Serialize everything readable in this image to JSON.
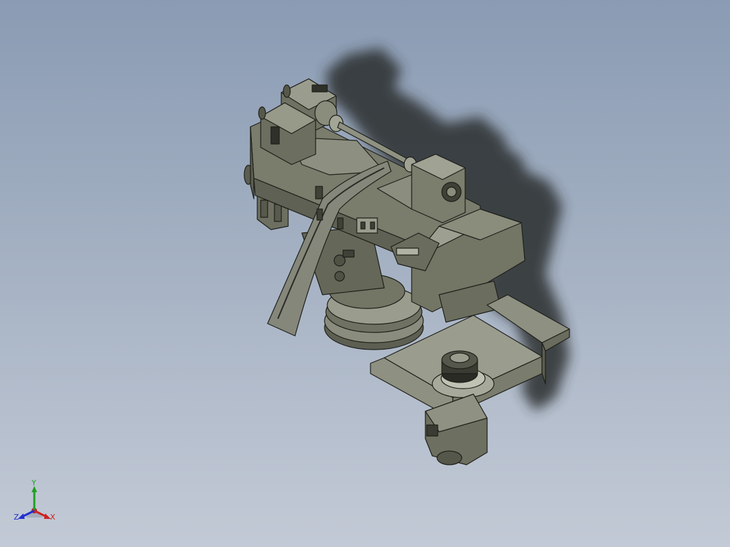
{
  "viewport": {
    "background_top": "#8a9bb3",
    "background_bottom": "#c3cad6",
    "model_color": "#737565",
    "edge_color": "#1e1f19"
  },
  "triad": {
    "x_label": "X",
    "y_label": "Y",
    "z_label": "Z",
    "x_color": "#d02020",
    "y_color": "#20a020",
    "z_color": "#2030d0"
  }
}
